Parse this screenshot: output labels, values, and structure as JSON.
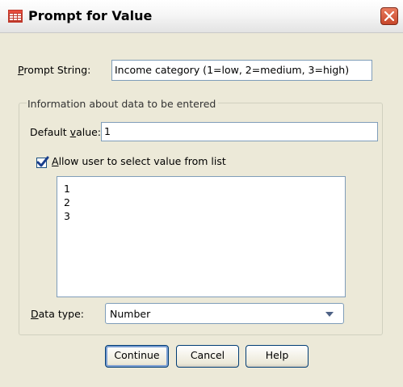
{
  "window": {
    "title": "Prompt for Value"
  },
  "prompt_string": {
    "label": "Prompt String:",
    "value": "Income category (1=low, 2=medium, 3=high)"
  },
  "group": {
    "title": "Information about data to be entered"
  },
  "default_value": {
    "label": "Default value:",
    "value": "1"
  },
  "allow_list": {
    "label": "Allow user to select value from list",
    "checked": true
  },
  "list_values": [
    "1",
    "2",
    "3"
  ],
  "data_type": {
    "label": "Data type:",
    "selected": "Number"
  },
  "buttons": {
    "continue": "Continue",
    "cancel": "Cancel",
    "help": "Help"
  }
}
